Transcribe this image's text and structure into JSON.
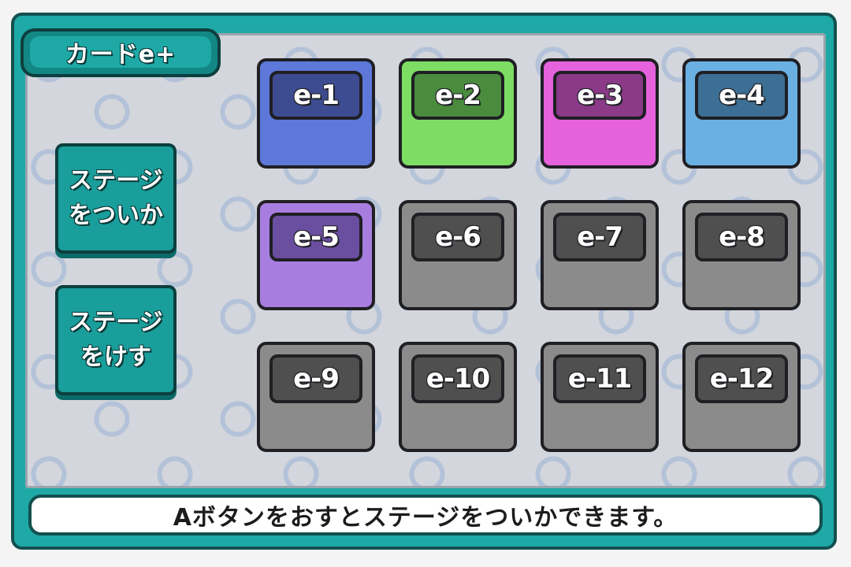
{
  "title": "カードe+",
  "buttons": {
    "add_stage": [
      "ステージ",
      "をついか"
    ],
    "remove_stage": [
      "ステージ",
      "をけす"
    ]
  },
  "cards": [
    {
      "label": "e-1",
      "body": "#5d78d8",
      "tag": "#3d4c90",
      "unlocked": true
    },
    {
      "label": "e-2",
      "body": "#7ddc63",
      "tag": "#4a8b3e",
      "unlocked": true
    },
    {
      "label": "e-3",
      "body": "#e562dc",
      "tag": "#8a3a86",
      "unlocked": true
    },
    {
      "label": "e-4",
      "body": "#6bb0e2",
      "tag": "#3d6e93",
      "unlocked": true
    },
    {
      "label": "e-5",
      "body": "#a77ee0",
      "tag": "#6a4fa0",
      "unlocked": true
    },
    {
      "label": "e-6",
      "body": "#8b8b8b",
      "tag": "#4f4f4f",
      "unlocked": false
    },
    {
      "label": "e-7",
      "body": "#8b8b8b",
      "tag": "#4f4f4f",
      "unlocked": false
    },
    {
      "label": "e-8",
      "body": "#8b8b8b",
      "tag": "#4f4f4f",
      "unlocked": false
    },
    {
      "label": "e-9",
      "body": "#8b8b8b",
      "tag": "#4f4f4f",
      "unlocked": false
    },
    {
      "label": "e-10",
      "body": "#8b8b8b",
      "tag": "#4f4f4f",
      "unlocked": false
    },
    {
      "label": "e-11",
      "body": "#8b8b8b",
      "tag": "#4f4f4f",
      "unlocked": false
    },
    {
      "label": "e-12",
      "body": "#8b8b8b",
      "tag": "#4f4f4f",
      "unlocked": false
    }
  ],
  "message": "Aボタンをおすとステージをついかできます。",
  "colors": {
    "frame": "#1ea9a6",
    "frame_border": "#12504f",
    "panel": "#d3d6dc"
  }
}
